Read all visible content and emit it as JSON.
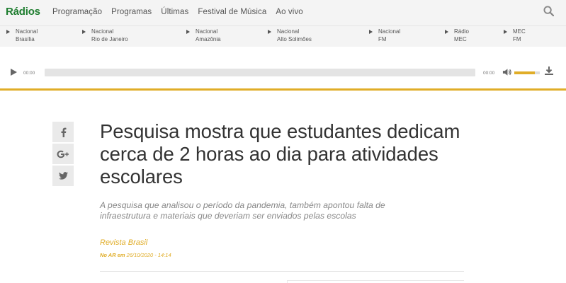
{
  "brand": "Rádios",
  "nav": {
    "items": [
      "Programação",
      "Programas",
      "Últimas",
      "Festival de Música",
      "Ao vivo"
    ]
  },
  "stations": [
    {
      "line1": "Nacional",
      "line2": "Brasília"
    },
    {
      "line1": "Nacional",
      "line2": "Rio de Janeiro"
    },
    {
      "line1": "Nacional",
      "line2": "Amazônia"
    },
    {
      "line1": "Nacional",
      "line2": "Alto Solimões"
    },
    {
      "line1": "Nacional",
      "line2": "FM"
    },
    {
      "line1": "Rádio",
      "line2": "MEC"
    },
    {
      "line1": "MEC",
      "line2": "FM"
    }
  ],
  "player": {
    "current_time": "00:00",
    "total_time": "00:00",
    "volume_level": 0.8,
    "accent_color": "#e0ad28"
  },
  "share": {
    "icons": [
      "facebook-icon",
      "google-plus-icon",
      "twitter-icon"
    ]
  },
  "article": {
    "title": "Pesquisa mostra que estudantes dedicam cerca de 2 horas ao dia para atividades escolares",
    "subtitle": "A pesquisa que analisou o período da pandemia, também apontou falta de infraestrutura e materiais que deveriam ser enviados pelas escolas",
    "program": "Revista Brasil",
    "aired_label": "No AR em",
    "aired_date": "26/10/2020 - 14:14"
  },
  "colors": {
    "brand_green": "#1e7d2f",
    "accent": "#e0ad28"
  }
}
